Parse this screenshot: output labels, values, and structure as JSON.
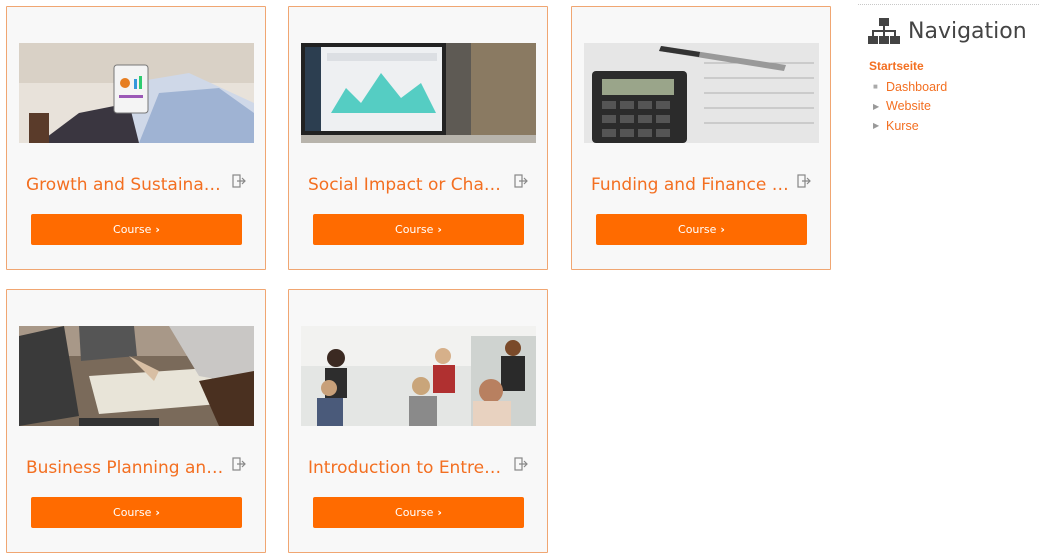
{
  "courses": [
    {
      "title": "Growth and Sustainabil...",
      "button": "Course"
    },
    {
      "title": "Social Impact or Change",
      "button": "Course"
    },
    {
      "title": "Funding and Finance M...",
      "button": "Course"
    },
    {
      "title": "Business Planning and...",
      "button": "Course"
    },
    {
      "title": "Introduction to Entrepr...",
      "button": "Course"
    }
  ],
  "navigation": {
    "title": "Navigation",
    "root": "Startseite",
    "items": [
      "Dashboard",
      "Website",
      "Kurse"
    ]
  },
  "colors": {
    "accent": "#ff6b00",
    "link": "#f36f21",
    "card_border": "#f0a672"
  }
}
